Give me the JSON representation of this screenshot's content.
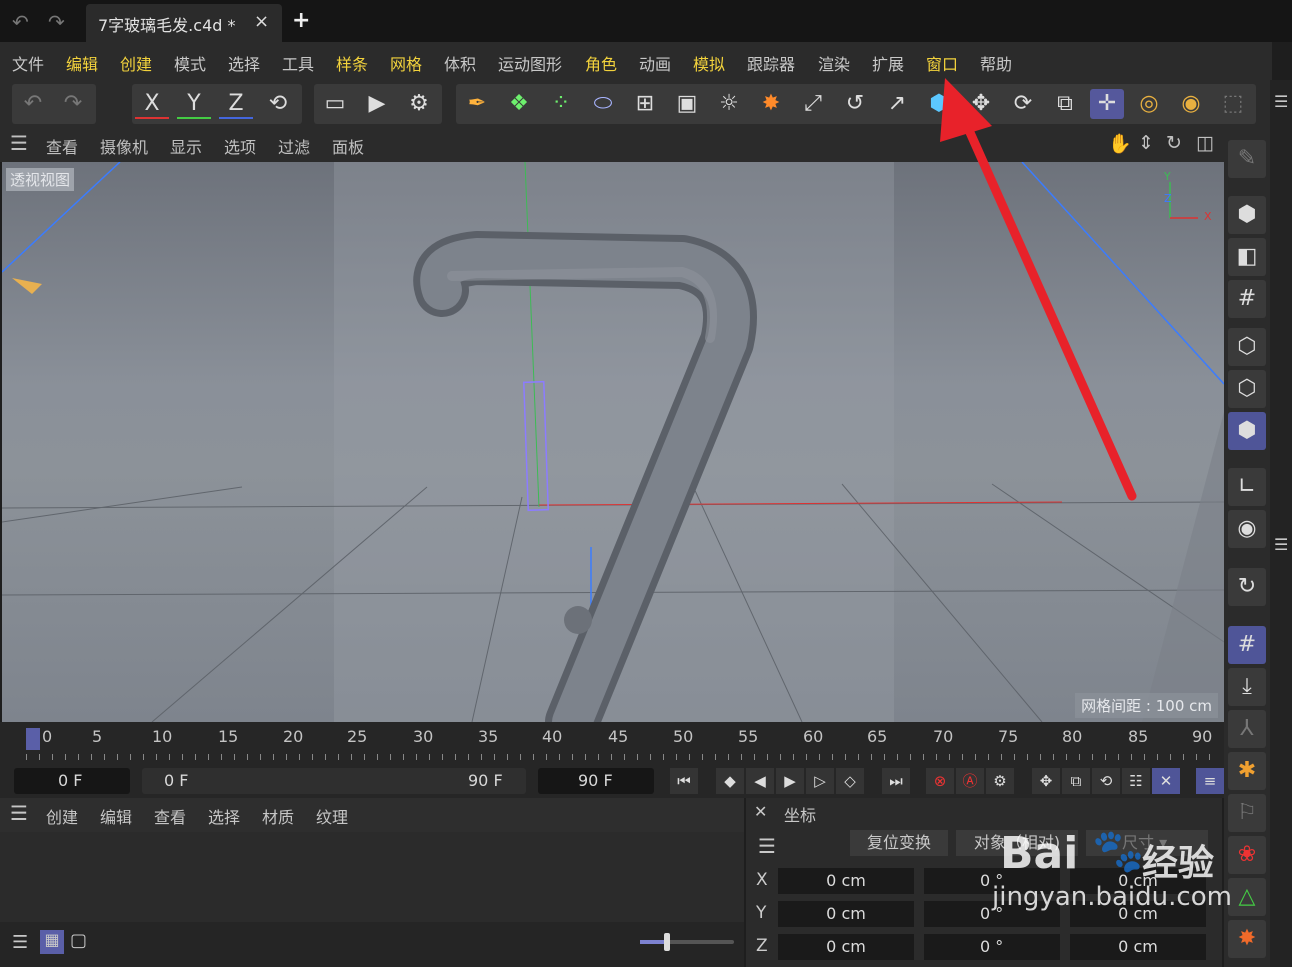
{
  "titlebar": {
    "document_tab": "7字玻璃毛发.c4d *",
    "close_glyph": "×",
    "new_tab_glyph": "+"
  },
  "menubar": {
    "items": [
      "文件",
      "编辑",
      "创建",
      "模式",
      "选择",
      "工具",
      "样条",
      "网格",
      "体积",
      "运动图形",
      "角色",
      "动画",
      "模拟",
      "跟踪器",
      "渲染",
      "扩展",
      "窗口",
      "帮助"
    ],
    "highlight_color": "#f2d23c"
  },
  "toolbar": {
    "axis_x": "X",
    "axis_y": "Y",
    "axis_z": "Z",
    "icons": [
      "undo-icon",
      "redo-icon",
      "axis-x",
      "axis-y",
      "axis-z",
      "coordinate-system-icon",
      "render-view-icon",
      "render-picture-viewer-icon",
      "render-settings-icon",
      "spline-pen-icon",
      "cube-points-icon",
      "cloner-icon",
      "deformer-icon",
      "grid-icon",
      "camera-icon",
      "light-icon",
      "effector-icon",
      "scale-axis-icon",
      "rotate-axis-icon",
      "move-axis-icon",
      "cube-primitive-icon",
      "move-icon",
      "rotate-icon",
      "scale-icon",
      "move-tool-icon",
      "select-live-icon",
      "select-rect-icon",
      "select-poly-icon"
    ]
  },
  "viewport_menu": {
    "items": [
      "查看",
      "摄像机",
      "显示",
      "选项",
      "过滤",
      "面板"
    ]
  },
  "viewport": {
    "label": "透视视图",
    "grid_spacing": "网格间距 : 100 cm",
    "axis_gizmo": {
      "y": "Y",
      "z": "Z",
      "x": "X"
    }
  },
  "timeline": {
    "ticks": [
      "0",
      "5",
      "10",
      "15",
      "20",
      "25",
      "30",
      "35",
      "40",
      "45",
      "50",
      "55",
      "60",
      "65",
      "70",
      "75",
      "80",
      "85",
      "90"
    ],
    "current_frame": "0 F",
    "range_start": "0 F",
    "range_end": "90 F",
    "max_frame": "90 F"
  },
  "object_manager": {
    "menu": [
      "创建",
      "编辑",
      "查看",
      "选择",
      "材质",
      "纹理"
    ]
  },
  "coordinates": {
    "title": "坐标",
    "reset_button": "复位变换",
    "mode_select": "对象（相对)",
    "size_select": "尺寸",
    "rows": [
      {
        "axis": "X",
        "pos": "0 cm",
        "rot": "0 °",
        "size": "0 cm"
      },
      {
        "axis": "Y",
        "pos": "0 cm",
        "rot": "0 °",
        "size": "0 cm"
      },
      {
        "axis": "Z",
        "pos": "0 cm",
        "rot": "0 °",
        "size": "0 cm"
      }
    ]
  },
  "watermark": {
    "brand": "Bai",
    "brand2": "经验",
    "url": "jingyan.baidu.com"
  },
  "colors": {
    "annotation_arrow": "#e8222a",
    "selection_accent": "#55589c",
    "menu_highlight": "#f2d23c"
  }
}
